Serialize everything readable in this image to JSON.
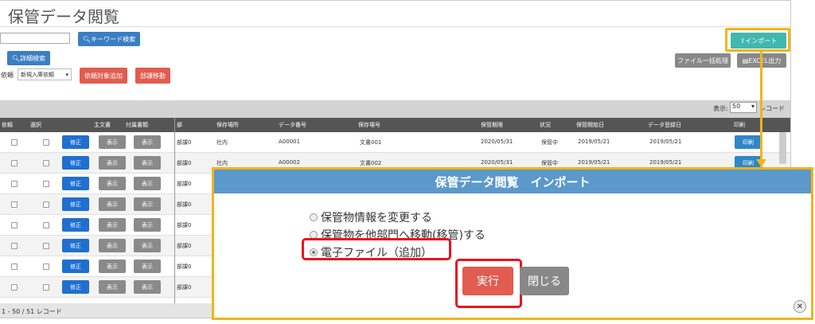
{
  "page": {
    "title": "保管データ閲覧",
    "keyword_search_label": "キーワード検索",
    "detail_search_label": "詳細検索",
    "request_label": "依頼",
    "request_select_value": "新規入庫依頼",
    "add_target_label": "依頼対象追加",
    "dept_move_label": "部課移動",
    "import_label": "インポート",
    "bulk_process_label": "ファイル一括処理",
    "excel_label": "EXCEL出力",
    "display_label": "表示:",
    "display_value": "50",
    "record_unit": "レコード",
    "footer_text": "1 - 50 / 51 レコード"
  },
  "table": {
    "headers": [
      "依頼",
      "選択",
      "主文書",
      "付属書類",
      "部",
      "保存場所",
      "データ番号",
      "保存場号",
      "保管期限",
      "状況",
      "保管開始日",
      "データ登録日",
      "印刷"
    ],
    "fix_label": "修正",
    "show_label": "表示",
    "print_label": "印刷",
    "rows": [
      {
        "dept": "部課0",
        "loc": "社内",
        "id": "A00001",
        "doc": "文書001",
        "limit": "2020/05/31",
        "status": "保管中",
        "start": "2019/05/21",
        "reg": "2019/05/21"
      },
      {
        "dept": "部課0",
        "loc": "社内",
        "id": "A00002",
        "doc": "文書002",
        "limit": "2020/05/31",
        "status": "保管中",
        "start": "2019/05/21",
        "reg": "2019/05/21"
      },
      {
        "dept": "部課0",
        "loc": "",
        "id": "",
        "doc": "",
        "limit": "",
        "status": "",
        "start": "",
        "reg": ""
      },
      {
        "dept": "部課0",
        "loc": "",
        "id": "",
        "doc": "",
        "limit": "",
        "status": "",
        "start": "",
        "reg": ""
      },
      {
        "dept": "部課0",
        "loc": "",
        "id": "",
        "doc": "",
        "limit": "",
        "status": "",
        "start": "",
        "reg": ""
      },
      {
        "dept": "部課0",
        "loc": "",
        "id": "",
        "doc": "",
        "limit": "",
        "status": "",
        "start": "",
        "reg": ""
      },
      {
        "dept": "部課0",
        "loc": "",
        "id": "",
        "doc": "",
        "limit": "",
        "status": "",
        "start": "",
        "reg": ""
      },
      {
        "dept": "部課0",
        "loc": "",
        "id": "",
        "doc": "",
        "limit": "",
        "status": "",
        "start": "",
        "reg": ""
      }
    ]
  },
  "dialog": {
    "title": "保管データ閲覧　インポート",
    "options": [
      {
        "label": "保管物情報を変更する",
        "selected": false
      },
      {
        "label": "保管物を他部門へ移動(移管)する",
        "selected": false
      },
      {
        "label": "電子ファイル（追加）",
        "selected": true
      }
    ],
    "execute_label": "実行",
    "close_label": "閉じる"
  },
  "colors": {
    "highlight": "#f2b418",
    "emphasis": "#e8141d",
    "header_blue": "#5b98cc"
  }
}
